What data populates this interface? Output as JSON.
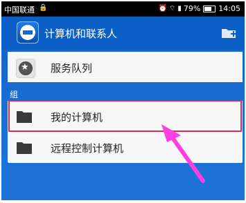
{
  "status_bar": {
    "carrier": "中国联通",
    "battery": "79%",
    "time": "14:05"
  },
  "app_bar": {
    "title": "计算机和联系人"
  },
  "items": {
    "service_queue": "服务队列",
    "my_computers": "我的计算机",
    "remote_control": "远程控制计算机"
  },
  "section": {
    "group_label": "组"
  },
  "colors": {
    "primary": "#0d5fc8",
    "highlight": "#d8294f",
    "annotation_arrow": "#ff3fe0"
  }
}
